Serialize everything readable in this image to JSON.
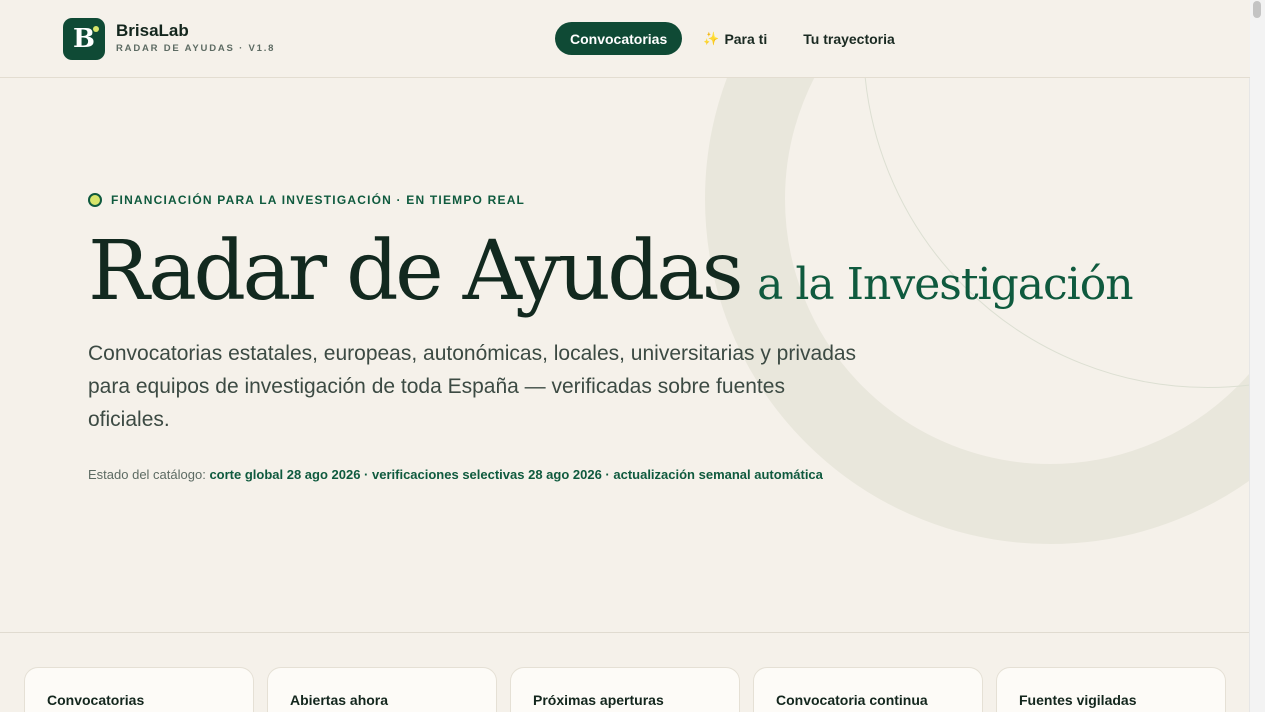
{
  "header": {
    "logo_letter": "B",
    "brand": "BrisaLab",
    "subtitle": "RADAR DE AYUDAS · V1.8",
    "nav": [
      {
        "label": "Convocatorias",
        "active": true
      },
      {
        "label": "Para ti",
        "icon": "sparkles-icon"
      },
      {
        "label": "Tu trayectoria"
      }
    ]
  },
  "hero": {
    "eyebrow": "FINANCIACIÓN PARA LA INVESTIGACIÓN · EN TIEMPO REAL",
    "title_main": "Radar de Ayudas",
    "title_sub": "a la Investigación",
    "lead": "Convocatorias estatales, europeas, autonómicas, locales, universitarias y privadas para equipos de investigación de toda España — verificadas sobre fuentes oficiales.",
    "status_label": "Estado del catálogo:",
    "status_value": "corte global 28 ago 2026 · verificaciones selectivas 28 ago 2026 · actualización semanal automática"
  },
  "stats": [
    {
      "label": "Convocatorias"
    },
    {
      "label": "Abiertas ahora"
    },
    {
      "label": "Próximas aperturas"
    },
    {
      "label": "Convocatoria continua"
    },
    {
      "label": "Fuentes vigiladas"
    }
  ],
  "colors": {
    "brand": "#0f4a35",
    "accent": "#d7e56b",
    "background": "#f5f1ea"
  }
}
